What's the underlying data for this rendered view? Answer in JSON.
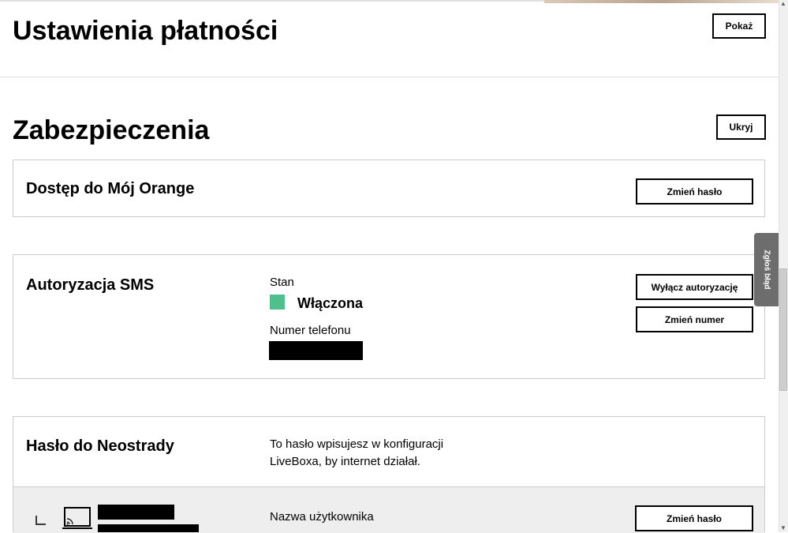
{
  "payment": {
    "title": "Ustawienia płatności",
    "show_label": "Pokaż"
  },
  "security": {
    "title": "Zabezpieczenia",
    "hide_label": "Ukryj",
    "my_orange": {
      "title": "Dostęp do Mój Orange",
      "change_password_label": "Zmień hasło"
    },
    "sms": {
      "title": "Autoryzacja SMS",
      "state_label": "Stan",
      "state_value": "Włączona",
      "state_color": "#4fbf8c",
      "phone_label": "Numer telefonu",
      "disable_label": "Wyłącz autoryzację",
      "change_number_label": "Zmień numer"
    },
    "neostrada": {
      "title": "Hasło do Neostrady",
      "description_line1": "To hasło wpisujesz w konfiguracji",
      "description_line2": "LiveBoxa, by internet działał.",
      "username_label": "Nazwa użytkownika",
      "change_password_label": "Zmień hasło",
      "device_icon": "laptop-cast-icon",
      "tree_icon": "tree-branch-icon"
    }
  },
  "report_bug": {
    "label": "Zgłoś błąd"
  }
}
